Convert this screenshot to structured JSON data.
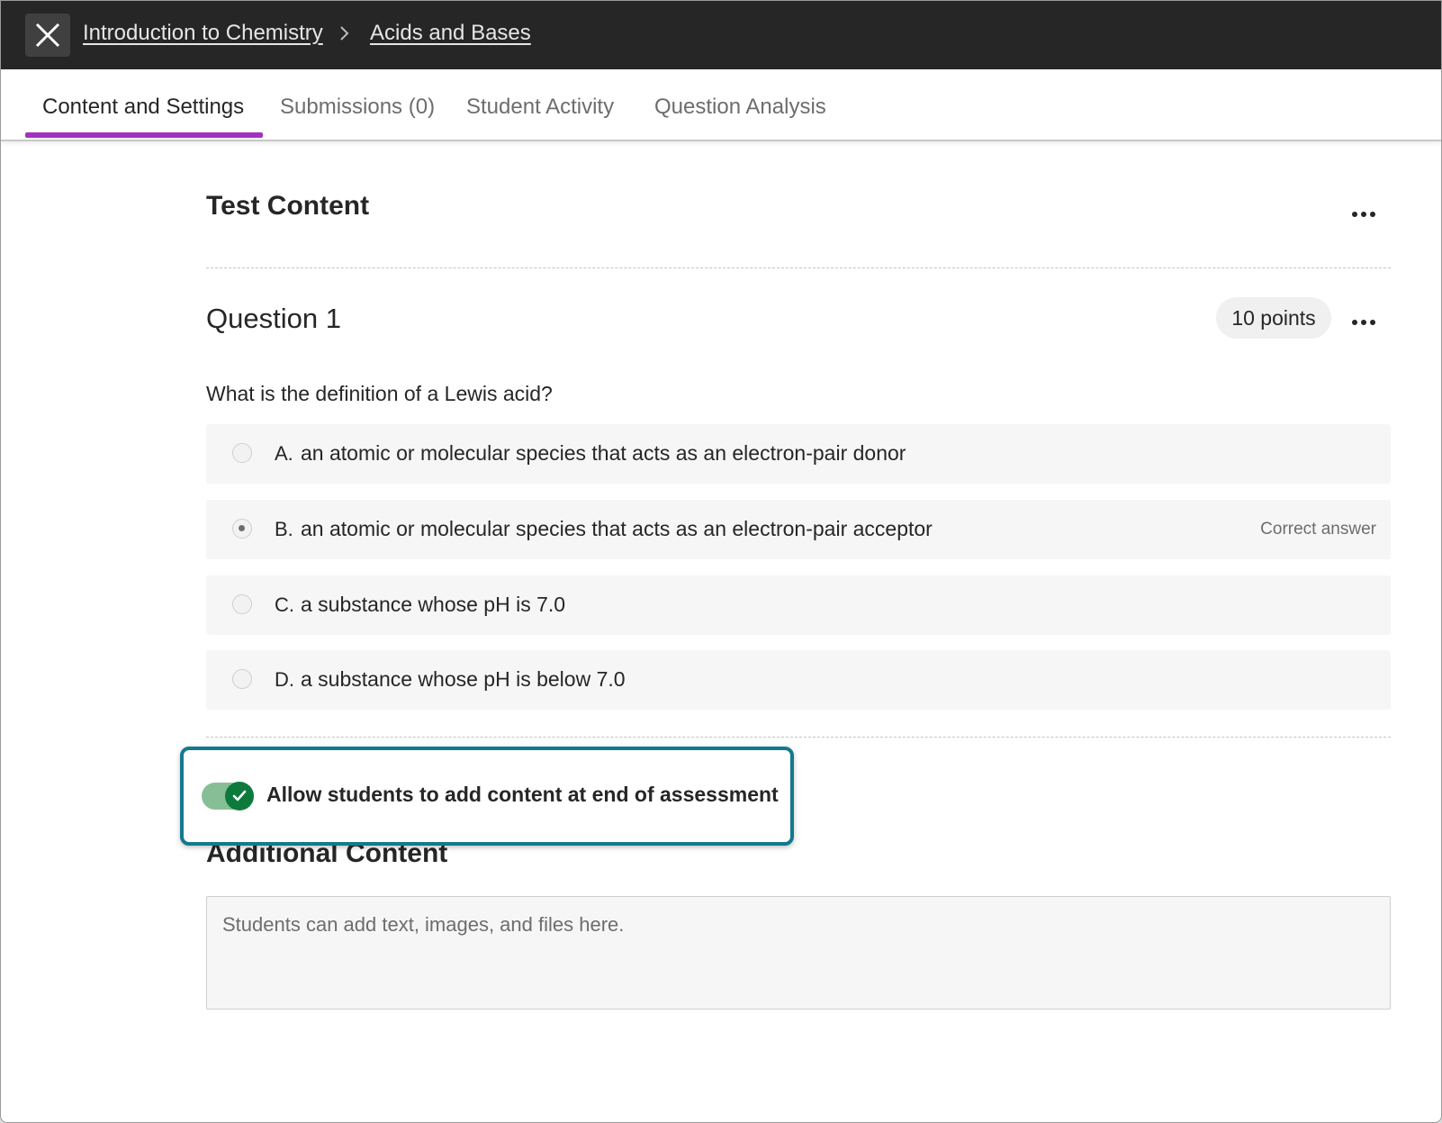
{
  "header": {
    "breadcrumbs": [
      "Introduction to Chemistry",
      "Acids and Bases"
    ],
    "close_icon": "close-icon",
    "separator_icon": "chevron-right-icon"
  },
  "tabs": [
    {
      "label": "Content and Settings",
      "active": true
    },
    {
      "label": "Submissions (0)",
      "active": false
    },
    {
      "label": "Student Activity",
      "active": false
    },
    {
      "label": "Question Analysis",
      "active": false
    }
  ],
  "test_content": {
    "title": "Test Content"
  },
  "question": {
    "title": "Question 1",
    "points": "10 points",
    "text": "What is the definition of a Lewis acid?",
    "options": [
      {
        "letter": "A.",
        "text": "an atomic or molecular species that acts as an electron-pair donor",
        "correct": false
      },
      {
        "letter": "B.",
        "text": "an atomic or molecular species that acts as an electron-pair acceptor",
        "correct": true
      },
      {
        "letter": "C.",
        "text": "a substance whose pH is 7.0",
        "correct": false
      },
      {
        "letter": "D.",
        "text": "a substance whose pH is below 7.0",
        "correct": false
      }
    ],
    "correct_label": "Correct answer"
  },
  "toggle": {
    "label": "Allow students to add content at end of assessment",
    "on": true
  },
  "additional": {
    "title": "Additional Content",
    "placeholder": "Students can add text, images, and files here."
  },
  "colors": {
    "accent": "#a132bf",
    "highlight": "#127a8c",
    "toggle_on": "#0d7a3c",
    "topbar": "#262626"
  }
}
